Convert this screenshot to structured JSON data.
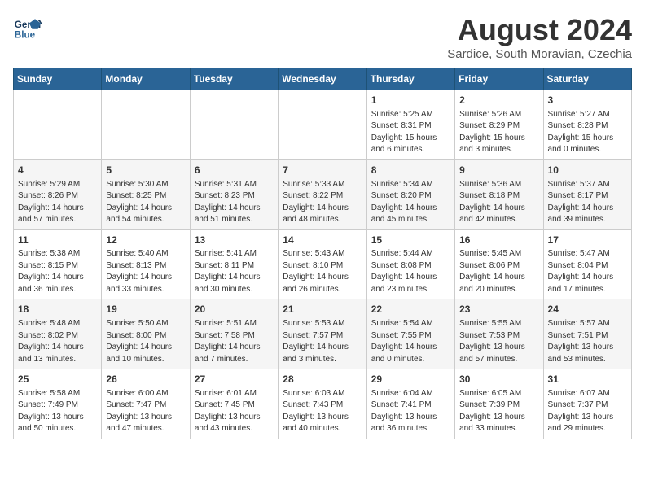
{
  "header": {
    "logo_line1": "General",
    "logo_line2": "Blue",
    "main_title": "August 2024",
    "subtitle": "Sardice, South Moravian, Czechia"
  },
  "calendar": {
    "days_of_week": [
      "Sunday",
      "Monday",
      "Tuesday",
      "Wednesday",
      "Thursday",
      "Friday",
      "Saturday"
    ],
    "weeks": [
      [
        {
          "day": "",
          "info": ""
        },
        {
          "day": "",
          "info": ""
        },
        {
          "day": "",
          "info": ""
        },
        {
          "day": "",
          "info": ""
        },
        {
          "day": "1",
          "info": "Sunrise: 5:25 AM\nSunset: 8:31 PM\nDaylight: 15 hours\nand 6 minutes."
        },
        {
          "day": "2",
          "info": "Sunrise: 5:26 AM\nSunset: 8:29 PM\nDaylight: 15 hours\nand 3 minutes."
        },
        {
          "day": "3",
          "info": "Sunrise: 5:27 AM\nSunset: 8:28 PM\nDaylight: 15 hours\nand 0 minutes."
        }
      ],
      [
        {
          "day": "4",
          "info": "Sunrise: 5:29 AM\nSunset: 8:26 PM\nDaylight: 14 hours\nand 57 minutes."
        },
        {
          "day": "5",
          "info": "Sunrise: 5:30 AM\nSunset: 8:25 PM\nDaylight: 14 hours\nand 54 minutes."
        },
        {
          "day": "6",
          "info": "Sunrise: 5:31 AM\nSunset: 8:23 PM\nDaylight: 14 hours\nand 51 minutes."
        },
        {
          "day": "7",
          "info": "Sunrise: 5:33 AM\nSunset: 8:22 PM\nDaylight: 14 hours\nand 48 minutes."
        },
        {
          "day": "8",
          "info": "Sunrise: 5:34 AM\nSunset: 8:20 PM\nDaylight: 14 hours\nand 45 minutes."
        },
        {
          "day": "9",
          "info": "Sunrise: 5:36 AM\nSunset: 8:18 PM\nDaylight: 14 hours\nand 42 minutes."
        },
        {
          "day": "10",
          "info": "Sunrise: 5:37 AM\nSunset: 8:17 PM\nDaylight: 14 hours\nand 39 minutes."
        }
      ],
      [
        {
          "day": "11",
          "info": "Sunrise: 5:38 AM\nSunset: 8:15 PM\nDaylight: 14 hours\nand 36 minutes."
        },
        {
          "day": "12",
          "info": "Sunrise: 5:40 AM\nSunset: 8:13 PM\nDaylight: 14 hours\nand 33 minutes."
        },
        {
          "day": "13",
          "info": "Sunrise: 5:41 AM\nSunset: 8:11 PM\nDaylight: 14 hours\nand 30 minutes."
        },
        {
          "day": "14",
          "info": "Sunrise: 5:43 AM\nSunset: 8:10 PM\nDaylight: 14 hours\nand 26 minutes."
        },
        {
          "day": "15",
          "info": "Sunrise: 5:44 AM\nSunset: 8:08 PM\nDaylight: 14 hours\nand 23 minutes."
        },
        {
          "day": "16",
          "info": "Sunrise: 5:45 AM\nSunset: 8:06 PM\nDaylight: 14 hours\nand 20 minutes."
        },
        {
          "day": "17",
          "info": "Sunrise: 5:47 AM\nSunset: 8:04 PM\nDaylight: 14 hours\nand 17 minutes."
        }
      ],
      [
        {
          "day": "18",
          "info": "Sunrise: 5:48 AM\nSunset: 8:02 PM\nDaylight: 14 hours\nand 13 minutes."
        },
        {
          "day": "19",
          "info": "Sunrise: 5:50 AM\nSunset: 8:00 PM\nDaylight: 14 hours\nand 10 minutes."
        },
        {
          "day": "20",
          "info": "Sunrise: 5:51 AM\nSunset: 7:58 PM\nDaylight: 14 hours\nand 7 minutes."
        },
        {
          "day": "21",
          "info": "Sunrise: 5:53 AM\nSunset: 7:57 PM\nDaylight: 14 hours\nand 3 minutes."
        },
        {
          "day": "22",
          "info": "Sunrise: 5:54 AM\nSunset: 7:55 PM\nDaylight: 14 hours\nand 0 minutes."
        },
        {
          "day": "23",
          "info": "Sunrise: 5:55 AM\nSunset: 7:53 PM\nDaylight: 13 hours\nand 57 minutes."
        },
        {
          "day": "24",
          "info": "Sunrise: 5:57 AM\nSunset: 7:51 PM\nDaylight: 13 hours\nand 53 minutes."
        }
      ],
      [
        {
          "day": "25",
          "info": "Sunrise: 5:58 AM\nSunset: 7:49 PM\nDaylight: 13 hours\nand 50 minutes."
        },
        {
          "day": "26",
          "info": "Sunrise: 6:00 AM\nSunset: 7:47 PM\nDaylight: 13 hours\nand 47 minutes."
        },
        {
          "day": "27",
          "info": "Sunrise: 6:01 AM\nSunset: 7:45 PM\nDaylight: 13 hours\nand 43 minutes."
        },
        {
          "day": "28",
          "info": "Sunrise: 6:03 AM\nSunset: 7:43 PM\nDaylight: 13 hours\nand 40 minutes."
        },
        {
          "day": "29",
          "info": "Sunrise: 6:04 AM\nSunset: 7:41 PM\nDaylight: 13 hours\nand 36 minutes."
        },
        {
          "day": "30",
          "info": "Sunrise: 6:05 AM\nSunset: 7:39 PM\nDaylight: 13 hours\nand 33 minutes."
        },
        {
          "day": "31",
          "info": "Sunrise: 6:07 AM\nSunset: 7:37 PM\nDaylight: 13 hours\nand 29 minutes."
        }
      ]
    ]
  }
}
